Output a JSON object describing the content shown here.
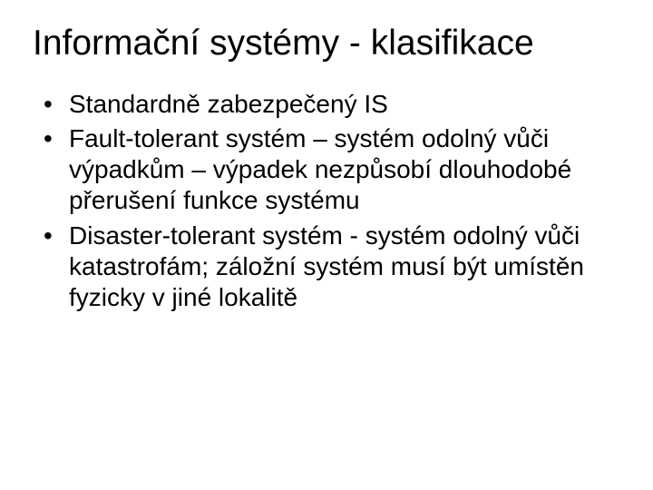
{
  "title": "Informační systémy - klasifikace",
  "bullets": [
    "Standardně zabezpečený IS",
    "Fault-tolerant systém – systém odolný vůči výpadkům – výpadek nezpůsobí dlouhodobé přerušení funkce systému",
    "Disaster-tolerant systém - systém odolný vůči katastrofám; záložní systém musí být umístěn fyzicky v jiné lokalitě"
  ]
}
